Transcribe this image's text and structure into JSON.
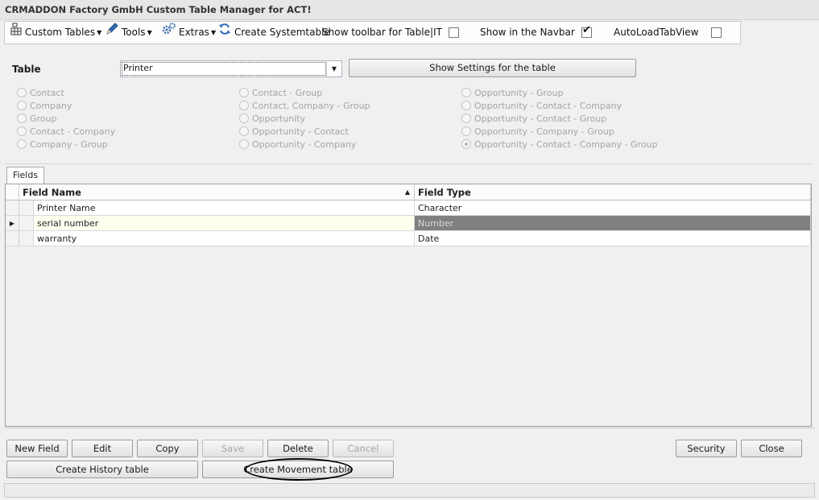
{
  "window": {
    "title": "CRMADDON Factory GmbH Custom Table Manager for ACT!"
  },
  "toolbar": {
    "custom_tables": {
      "label": "Custom Tables",
      "icon": "table-icon"
    },
    "tools": {
      "label": "Tools",
      "icon": "pen-icon"
    },
    "extras": {
      "label": "Extras",
      "icon": "gears-icon"
    },
    "create_systemtable": {
      "label": "Create Systemtable",
      "icon": "refresh-icon"
    },
    "show_toolbar": {
      "label": "Show toolbar for Table|IT",
      "checked": false
    },
    "show_navbar": {
      "label": "Show in the Navbar",
      "checked": true
    },
    "autoload": {
      "label": "AutoLoadTabView",
      "checked": false
    }
  },
  "settings": {
    "table_label": "Table",
    "table_value": "Printer",
    "show_settings_label": "Show Settings for the table",
    "radio_col1": [
      "Contact",
      "Company",
      "Group",
      "Contact - Company",
      "Company - Group"
    ],
    "radio_col2": [
      "Contact - Group",
      "Contact, Company - Group",
      "Opportunity",
      "Opportunity - Contact",
      "Opportunity - Company"
    ],
    "radio_col3": [
      "Opportunity - Group",
      "Opportunity - Contact - Company",
      "Opportunity - Contact - Group",
      "Opportunity - Company - Group",
      "Opportunity - Contact - Company - Group"
    ],
    "selected_radio": "Opportunity - Contact - Company - Group"
  },
  "tabs": {
    "fields": "Fields"
  },
  "grid": {
    "columns": [
      "Field Name",
      "Field Type"
    ],
    "sort_indicator": "▲",
    "rows": [
      {
        "name": "Printer Name",
        "type": "Character"
      },
      {
        "name": "serial number",
        "type": "Number"
      },
      {
        "name": "warranty",
        "type": "Date"
      }
    ],
    "row_pointer": "▶"
  },
  "buttons": {
    "new_field": "New Field",
    "edit": "Edit",
    "copy": "Copy",
    "save": "Save",
    "delete": "Delete",
    "cancel": "Cancel",
    "security": "Security",
    "close": "Close",
    "create_history": "Create History table",
    "create_movement": "Create Movement table"
  },
  "colors": {
    "accent_blue": "#2f6db5",
    "selected_cell": "#808080",
    "current_row": "#fffff0"
  }
}
